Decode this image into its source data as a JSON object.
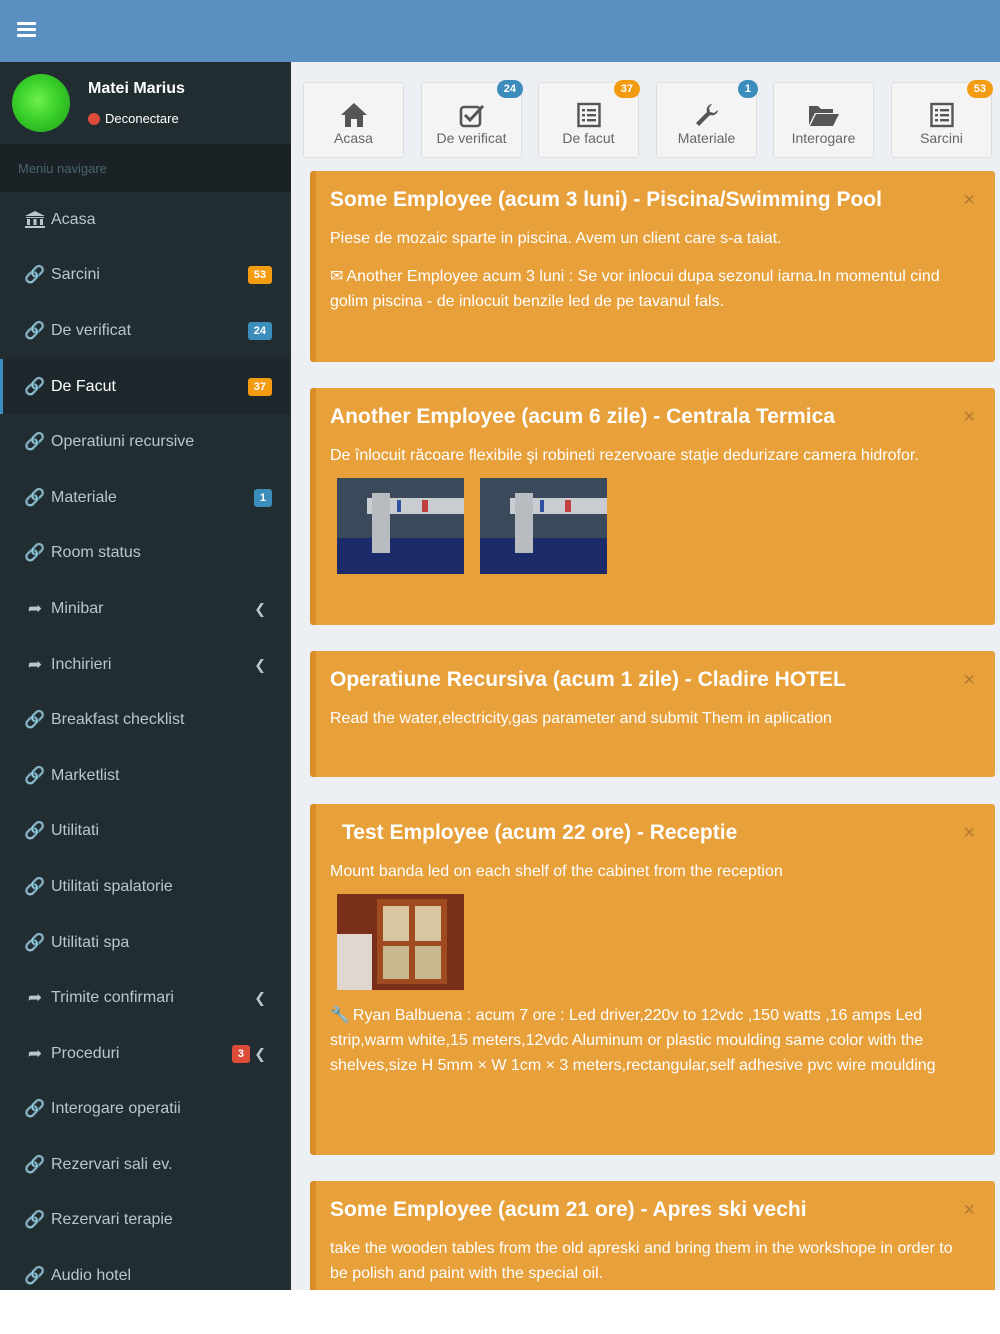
{
  "sidebar": {
    "user": {
      "name": "Matei Marius",
      "status": "Deconectare"
    },
    "header": "Meniu navigare",
    "items": [
      {
        "label": "Acasa",
        "icon": "bank-icon"
      },
      {
        "label": "Sarcini",
        "icon": "link-icon",
        "badge": "53"
      },
      {
        "label": "De verificat",
        "icon": "link-icon",
        "badge": "24"
      },
      {
        "label": "De Facut",
        "icon": "link-icon",
        "badge": "37"
      },
      {
        "label": "Operatiuni recursive",
        "icon": "link-icon"
      },
      {
        "label": "Materiale",
        "icon": "link-icon",
        "badge": "1"
      },
      {
        "label": "Room status",
        "icon": "link-icon"
      },
      {
        "label": "Minibar",
        "icon": "share-icon"
      },
      {
        "label": "Inchirieri",
        "icon": "share-icon"
      },
      {
        "label": "Breakfast checklist",
        "icon": "link-icon"
      },
      {
        "label": "Marketlist",
        "icon": "link-icon"
      },
      {
        "label": "Utilitati",
        "icon": "link-icon"
      },
      {
        "label": "Utilitati spalatorie",
        "icon": "link-icon"
      },
      {
        "label": "Utilitati spa",
        "icon": "link-icon"
      },
      {
        "label": "Trimite confirmari",
        "icon": "share-icon"
      },
      {
        "label": "Proceduri",
        "icon": "share-icon",
        "badge": "3"
      },
      {
        "label": "Interogare operatii",
        "icon": "link-icon"
      },
      {
        "label": "Rezervari sali ev.",
        "icon": "link-icon"
      },
      {
        "label": "Rezervari terapie",
        "icon": "link-icon"
      },
      {
        "label": "Audio hotel",
        "icon": "link-icon"
      }
    ]
  },
  "shortcuts": [
    {
      "label": "Acasa",
      "icon": "home-icon"
    },
    {
      "label": "De verificat",
      "icon": "check-square-icon",
      "badge": "24"
    },
    {
      "label": "De facut",
      "icon": "list-icon",
      "badge": "37"
    },
    {
      "label": "Materiale",
      "icon": "wrench-icon",
      "badge": "1"
    },
    {
      "label": "Interogare",
      "icon": "folder-open-icon"
    },
    {
      "label": "Sarcini",
      "icon": "list-icon",
      "badge": "53"
    }
  ],
  "cards": [
    {
      "title": "Some Employee (acum 3 luni) - Piscina/Swimming Pool",
      "text": "Piese de mozaic sparte in piscina. Avem un client care s-a taiat.",
      "comment": "Another Employee acum 3 luni : Se vor inlocui dupa sezonul iarna.In momentul cind golim piscina - de inlocuit benzile led de pe tavanul fals.",
      "comment_icon": "envelope-icon"
    },
    {
      "title": "Another Employee (acum 6 zile) - Centrala Termica",
      "text": "De înlocuit răcoare flexibile şi robineti rezervoare staţie dedurizare camera hidrofor."
    },
    {
      "title": "Operatiune Recursiva (acum 1 zile) - Cladire HOTEL",
      "text": "Read the water,electricity,gas parameter and submit Them in aplication"
    },
    {
      "title": "Test Employee (acum 22 ore) - Receptie",
      "text": "Mount banda led on each shelf of the cabinet from the reception",
      "comment": "Ryan Balbuena : acum 7 ore : Led driver,220v to 12vdc ,150 watts ,16 amps Led strip,warm white,15 meters,12vdc Aluminum or plastic moulding same color with the shelves,size H 5mm × W 1cm × 3 meters,rectangular,self adhesive pvc wire moulding",
      "comment_icon": "wrench-icon"
    },
    {
      "title": "Some Employee (acum 21 ore) - Apres ski vechi",
      "text": "take the wooden tables from the old apreski and bring them in the workshope in order to be polish and paint with the special oil."
    }
  ],
  "close_symbol": "×",
  "colors": {
    "topbar": "#5a8fc2",
    "sidebar": "#222d32",
    "callout": "#e8a03a"
  }
}
